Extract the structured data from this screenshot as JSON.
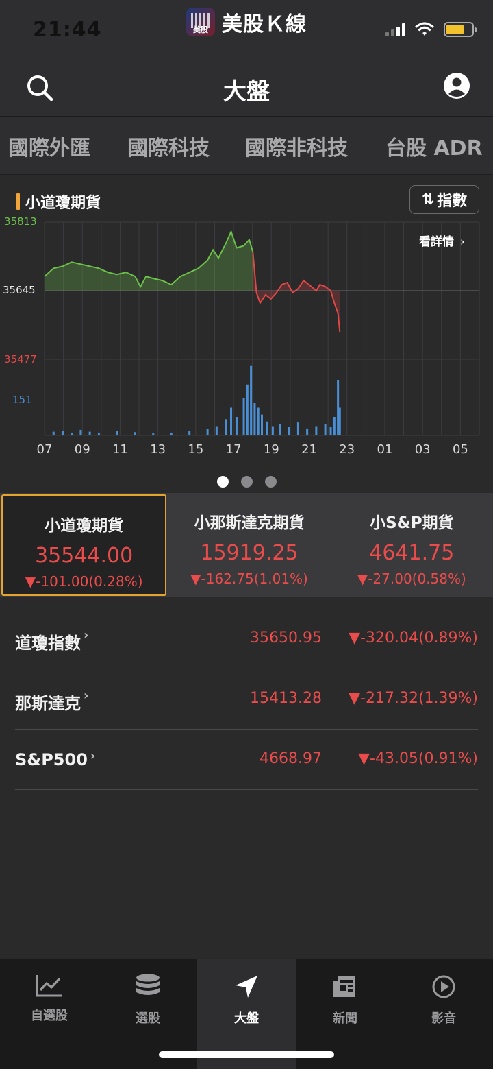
{
  "status": {
    "time": "21:44",
    "app_name": "美股Ｋ線",
    "app_icon_label": "美股"
  },
  "nav": {
    "title": "大盤"
  },
  "tabs": [
    "國際外匯",
    "國際科技",
    "國際非科技",
    "台股 ADR"
  ],
  "chart_section": {
    "title": "小道瓊期貨",
    "index_button": "指數",
    "detail_link": "看詳情",
    "accent": "#f2a33a"
  },
  "chart_data": {
    "type": "line",
    "series_up_color": "#6cc04a",
    "series_down_color": "#e04848",
    "volume_color": "#4a8fd4",
    "y_top": "35813",
    "y_ref": "35645",
    "y_bottom": "35477",
    "y_range": [
      35477,
      35813
    ],
    "reference": 35645,
    "volume_label": "151",
    "x_ticks": [
      "07",
      "09",
      "11",
      "13",
      "15",
      "17",
      "19",
      "21",
      "23",
      "01",
      "03",
      "05"
    ],
    "x_range_hours": [
      7,
      31
    ],
    "price_points": [
      [
        7.0,
        35680
      ],
      [
        7.5,
        35700
      ],
      [
        8.0,
        35705
      ],
      [
        8.5,
        35715
      ],
      [
        9.0,
        35710
      ],
      [
        9.5,
        35705
      ],
      [
        10.0,
        35700
      ],
      [
        10.5,
        35690
      ],
      [
        11.0,
        35685
      ],
      [
        11.5,
        35690
      ],
      [
        12.0,
        35680
      ],
      [
        12.3,
        35655
      ],
      [
        12.6,
        35680
      ],
      [
        13.0,
        35675
      ],
      [
        13.5,
        35670
      ],
      [
        14.0,
        35660
      ],
      [
        14.5,
        35680
      ],
      [
        15.0,
        35690
      ],
      [
        15.5,
        35700
      ],
      [
        16.0,
        35720
      ],
      [
        16.3,
        35745
      ],
      [
        16.6,
        35725
      ],
      [
        17.0,
        35760
      ],
      [
        17.3,
        35790
      ],
      [
        17.6,
        35750
      ],
      [
        18.0,
        35755
      ],
      [
        18.3,
        35770
      ],
      [
        18.5,
        35740
      ],
      [
        18.7,
        35640
      ],
      [
        18.9,
        35615
      ],
      [
        19.2,
        35635
      ],
      [
        19.5,
        35625
      ],
      [
        19.8,
        35640
      ],
      [
        20.1,
        35660
      ],
      [
        20.4,
        35665
      ],
      [
        20.7,
        35640
      ],
      [
        21.0,
        35650
      ],
      [
        21.3,
        35670
      ],
      [
        21.6,
        35660
      ],
      [
        22.0,
        35645
      ],
      [
        22.2,
        35660
      ],
      [
        22.5,
        35655
      ],
      [
        22.8,
        35645
      ],
      [
        23.0,
        35615
      ],
      [
        23.2,
        35590
      ],
      [
        23.3,
        35544
      ]
    ],
    "volume_points": [
      [
        7.5,
        8
      ],
      [
        8.0,
        10
      ],
      [
        8.5,
        6
      ],
      [
        9.0,
        12
      ],
      [
        9.5,
        8
      ],
      [
        10.0,
        6
      ],
      [
        11.0,
        9
      ],
      [
        12.0,
        7
      ],
      [
        13.0,
        5
      ],
      [
        14.0,
        6
      ],
      [
        15.0,
        10
      ],
      [
        16.0,
        14
      ],
      [
        16.5,
        20
      ],
      [
        17.0,
        35
      ],
      [
        17.3,
        60
      ],
      [
        17.6,
        40
      ],
      [
        18.0,
        80
      ],
      [
        18.2,
        110
      ],
      [
        18.4,
        150
      ],
      [
        18.6,
        70
      ],
      [
        18.8,
        60
      ],
      [
        19.0,
        45
      ],
      [
        19.3,
        30
      ],
      [
        19.6,
        20
      ],
      [
        20.0,
        25
      ],
      [
        20.5,
        18
      ],
      [
        21.0,
        28
      ],
      [
        21.5,
        15
      ],
      [
        22.0,
        20
      ],
      [
        22.5,
        25
      ],
      [
        22.8,
        18
      ],
      [
        23.0,
        40
      ],
      [
        23.2,
        120
      ],
      [
        23.3,
        60
      ]
    ]
  },
  "futures": [
    {
      "name": "小道瓊期貨",
      "price": "35544.00",
      "change": "▼-101.00(0.28%)",
      "selected": true
    },
    {
      "name": "小那斯達克期貨",
      "price": "15919.25",
      "change": "▼-162.75(1.01%)",
      "selected": false
    },
    {
      "name": "小S&P期貨",
      "price": "4641.75",
      "change": "▼-27.00(0.58%)",
      "selected": false
    }
  ],
  "indices": [
    {
      "name": "道瓊指數",
      "value": "35650.95",
      "change": "▼-320.04(0.89%)"
    },
    {
      "name": "那斯達克",
      "value": "15413.28",
      "change": "▼-217.32(1.39%)"
    },
    {
      "name": "S&P500",
      "value": "4668.97",
      "change": "▼-43.05(0.91%)"
    }
  ],
  "tabbar": [
    {
      "label": "自選股",
      "icon": "chart-line-icon",
      "active": false
    },
    {
      "label": "選股",
      "icon": "database-icon",
      "active": false
    },
    {
      "label": "大盤",
      "icon": "navigation-arrow-icon",
      "active": true
    },
    {
      "label": "新聞",
      "icon": "newspaper-icon",
      "active": false
    },
    {
      "label": "影音",
      "icon": "play-circle-icon",
      "active": false
    }
  ]
}
